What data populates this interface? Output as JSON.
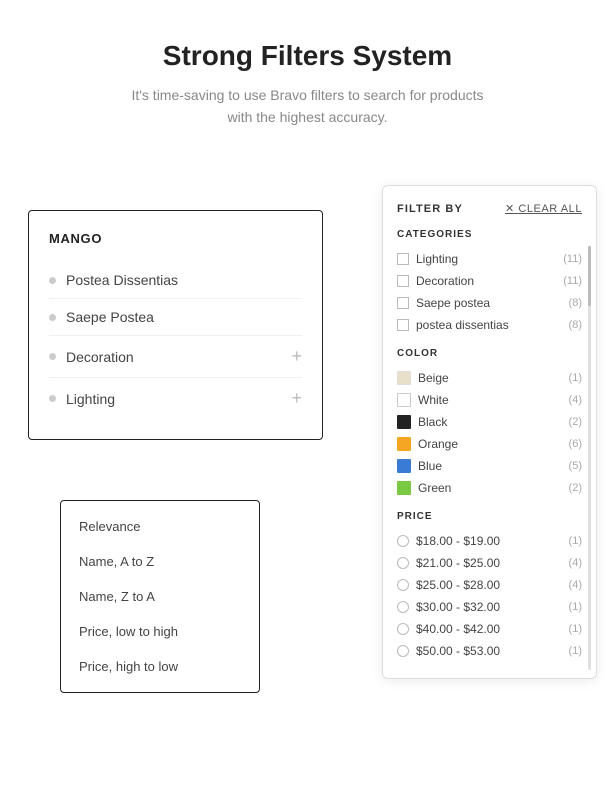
{
  "header": {
    "title": "Strong Filters System",
    "subtitle": "It's time-saving to use Bravo filters to search for products\nwith the highest accuracy."
  },
  "nav_panel": {
    "title": "MANGO",
    "items": [
      {
        "label": "Postea Dissentias",
        "has_plus": false
      },
      {
        "label": "Saepe Postea",
        "has_plus": false
      },
      {
        "label": "Decoration",
        "has_plus": true
      },
      {
        "label": "Lighting",
        "has_plus": true
      }
    ]
  },
  "sort_panel": {
    "items": [
      "Relevance",
      "Name, A to Z",
      "Name, Z to A",
      "Price, low to high",
      "Price, high to low"
    ]
  },
  "filter_panel": {
    "header": "FILTER BY",
    "clear_all": "CLEAR ALL",
    "categories_label": "CATEGORIES",
    "categories": [
      {
        "label": "Lighting",
        "count": "11"
      },
      {
        "label": "Decoration",
        "count": "11"
      },
      {
        "label": "Saepe postea",
        "count": "8"
      },
      {
        "label": "postea dissentias",
        "count": "8"
      }
    ],
    "color_label": "COLOR",
    "colors": [
      {
        "label": "Beige",
        "count": "1",
        "hex": "#e8e0c8"
      },
      {
        "label": "White",
        "count": "4",
        "hex": "#ffffff"
      },
      {
        "label": "Black",
        "count": "2",
        "hex": "#222222"
      },
      {
        "label": "Orange",
        "count": "6",
        "hex": "#f5a623"
      },
      {
        "label": "Blue",
        "count": "5",
        "hex": "#3a7bd5"
      },
      {
        "label": "Green",
        "count": "2",
        "hex": "#7ac943"
      }
    ],
    "price_label": "PRICE",
    "prices": [
      {
        "label": "$18.00 - $19.00",
        "count": "1"
      },
      {
        "label": "$21.00 - $25.00",
        "count": "4"
      },
      {
        "label": "$25.00 - $28.00",
        "count": "4"
      },
      {
        "label": "$30.00 - $32.00",
        "count": "1"
      },
      {
        "label": "$40.00 - $42.00",
        "count": "1"
      },
      {
        "label": "$50.00 - $53.00",
        "count": "1"
      }
    ]
  }
}
